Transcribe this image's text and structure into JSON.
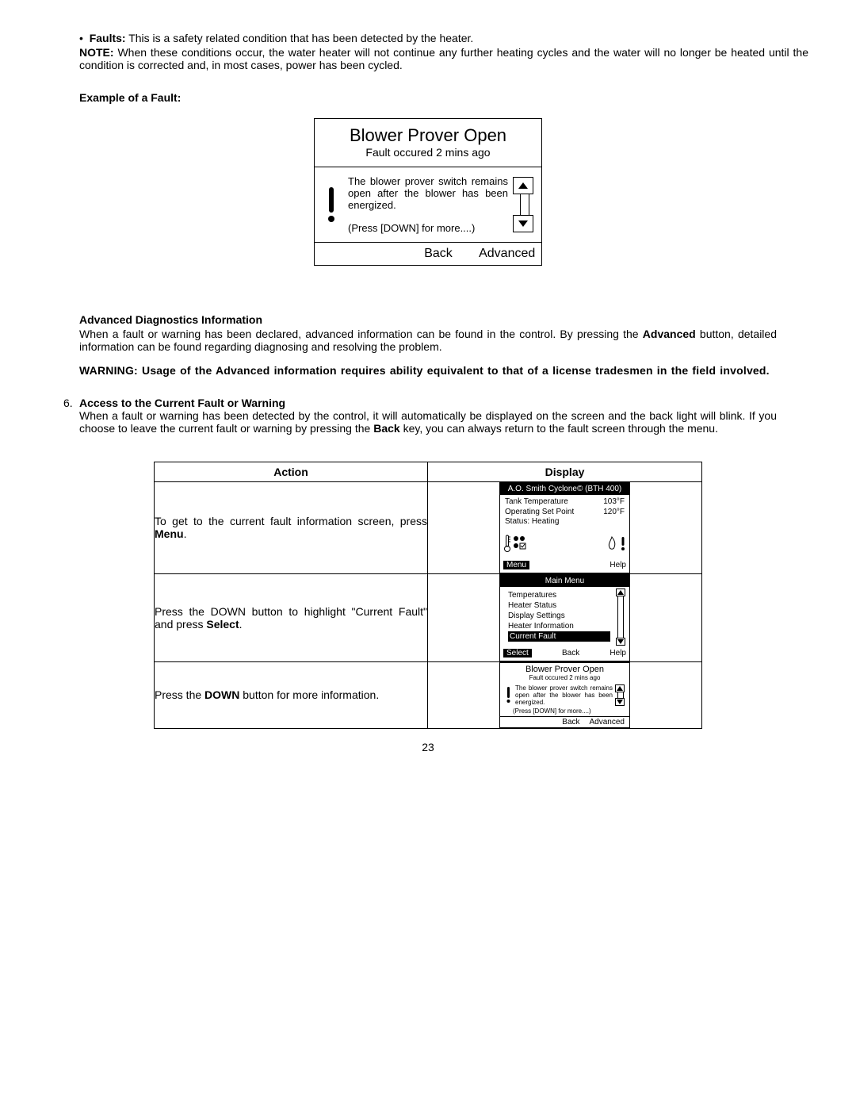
{
  "intro": {
    "faults_label": "Faults:",
    "faults_text": " This is a safety related condition that has been detected by the heater.",
    "note_label": "NOTE:",
    "note_text": " When these conditions occur, the water heater will not continue any further heating cycles and the water will no longer be heated until the condition is corrected and, in most cases, power has been cycled."
  },
  "example_heading": "Example of a Fault:",
  "big_display": {
    "title": "Blower Prover Open",
    "sub": "Fault occured 2 mins ago",
    "body": "The blower prover switch remains open after the blower has been energized.",
    "press": "(Press [DOWN] for more....)",
    "back": "Back",
    "advanced": "Advanced"
  },
  "adv": {
    "heading": "Advanced Diagnostics Information",
    "p1a": "When a fault or warning has been declared, advanced information can be found in the control. By pressing the ",
    "p1b": "Advanced",
    "p1c": " button, detailed information can be found regarding diagnosing and resolving the problem.",
    "warn": "WARNING: Usage of the Advanced information requires ability equivalent to that of a license tradesmen in the field involved."
  },
  "access": {
    "num": "6.",
    "heading": "Access to the Current Fault or Warning",
    "p1a": "When a fault or warning has been detected by the control, it will automatically be displayed on the screen and the back light will blink. If you choose to leave the current fault or warning by pressing the ",
    "p1b": "Back",
    "p1c": " key, you can always return to the fault screen through the menu."
  },
  "table": {
    "th_action": "Action",
    "th_display": "Display",
    "row1_a": "To get to the current fault information screen, press ",
    "row1_b": "Menu",
    "row1_c": ".",
    "row2_a": "Press the DOWN button to highlight \"Current Fault\" and press ",
    "row2_b": "Select",
    "row2_c": ".",
    "row3_a": "Press the ",
    "row3_b": "DOWN",
    "row3_c": " button for more information."
  },
  "lcd1": {
    "header": "A.O. Smith Cyclone© (BTH 400)",
    "r1l": "Tank Temperature",
    "r1r": "103°F",
    "r2l": "Operating Set Point",
    "r2r": "120°F",
    "r3l": "Status: Heating",
    "menu": "Menu",
    "help": "Help"
  },
  "lcd2": {
    "header": "Main Menu",
    "i1": "Temperatures",
    "i2": "Heater Status",
    "i3": "Display Settings",
    "i4": "Heater Information",
    "i5": "Current Fault",
    "select": "Select",
    "back": "Back",
    "help": "Help"
  },
  "lcd3": {
    "title": "Blower Prover Open",
    "sub": "Fault occured 2 mins ago",
    "body": "The blower prover switch remains open after the blower has been energized.",
    "press": "(Press [DOWN] for more....)",
    "back": "Back",
    "adv": "Advanced"
  },
  "page_num": "23"
}
